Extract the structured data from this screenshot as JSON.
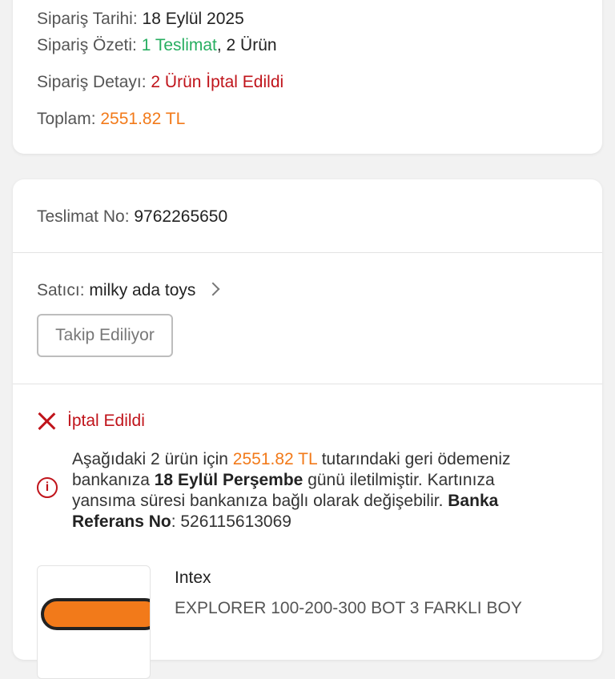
{
  "order_summary": {
    "date_label": "Sipariş Tarihi:",
    "date_value": "18 Eylül 2025",
    "summary_label": "Sipariş Özeti:",
    "summary_delivery": "1 Teslimat",
    "summary_rest": ", 2 Ürün",
    "detail_label": "Sipariş Detayı:",
    "detail_value": "2 Ürün İptal Edildi",
    "total_label": "Toplam:",
    "total_value": "2551.82 TL"
  },
  "delivery": {
    "number_label": "Teslimat No:",
    "number_value": "9762265650",
    "seller_label": "Satıcı:",
    "seller_name": "milky ada toys",
    "follow_button": "Takip Ediliyor",
    "status": "İptal Edildi",
    "refund": {
      "p1": "Aşağıdaki 2 ürün için ",
      "amount": "2551.82 TL",
      "p2": " tutarındaki geri ödemeniz bankanıza ",
      "date": "18 Eylül Perşembe",
      "p3": " günü iletilmiştir. Kartınıza yansıma süresi bankanıza bağlı olarak değişebilir. ",
      "ref_label": "Banka Referans No",
      "ref_value": ": 526115613069"
    },
    "product": {
      "brand": "Intex",
      "name": "EXPLORER  100-200-300 BOT 3  FARKLI BOY"
    }
  },
  "colors": {
    "accent_orange": "#f27a1a",
    "success_green": "#27ae60",
    "cancel_red": "#c0141b"
  },
  "icons": [
    "chevron-right-icon",
    "close-icon",
    "info-icon"
  ]
}
